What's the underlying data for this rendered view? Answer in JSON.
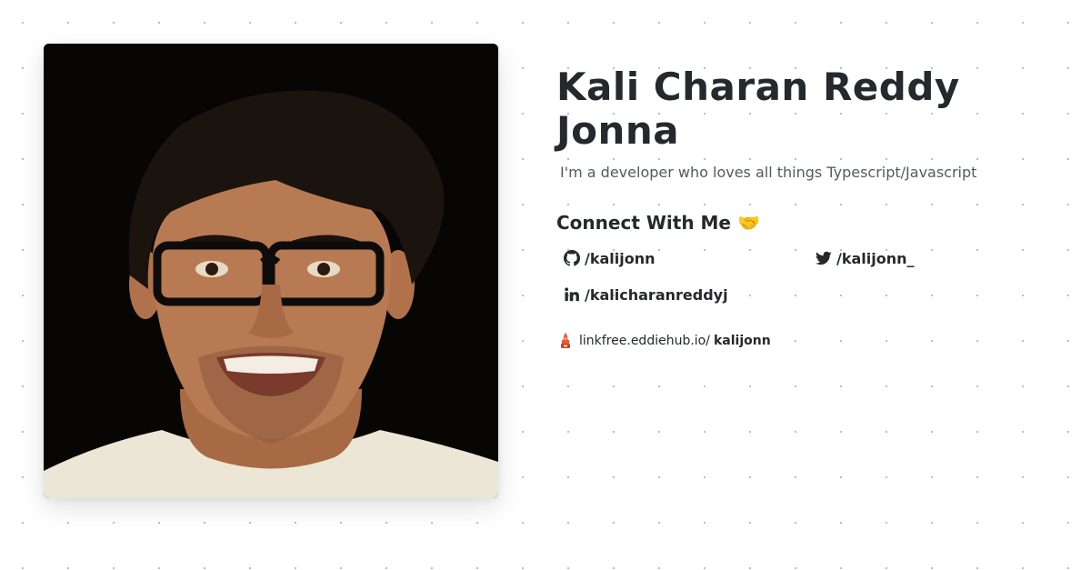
{
  "profile": {
    "name": "Kali Charan Reddy Jonna",
    "tagline": "I'm a developer who loves all things Typescript/Javascript",
    "photo_icon": "profile-photo"
  },
  "connect": {
    "title": "Connect With Me 🤝",
    "links": [
      {
        "icon": "github-icon",
        "label": "/kalijonn"
      },
      {
        "icon": "twitter-icon",
        "label": "/kalijonn_"
      },
      {
        "icon": "linkedin-icon",
        "label": "/kalicharanreddyj"
      }
    ]
  },
  "footer": {
    "logo_icon": "linkfree-logo-icon",
    "domain": "linkfree.eddiehub.io/",
    "handle": "kalijonn"
  },
  "colors": {
    "text": "#24292e",
    "muted": "#555a60",
    "background": "#ffffff",
    "dots": "#b8b8b8"
  }
}
